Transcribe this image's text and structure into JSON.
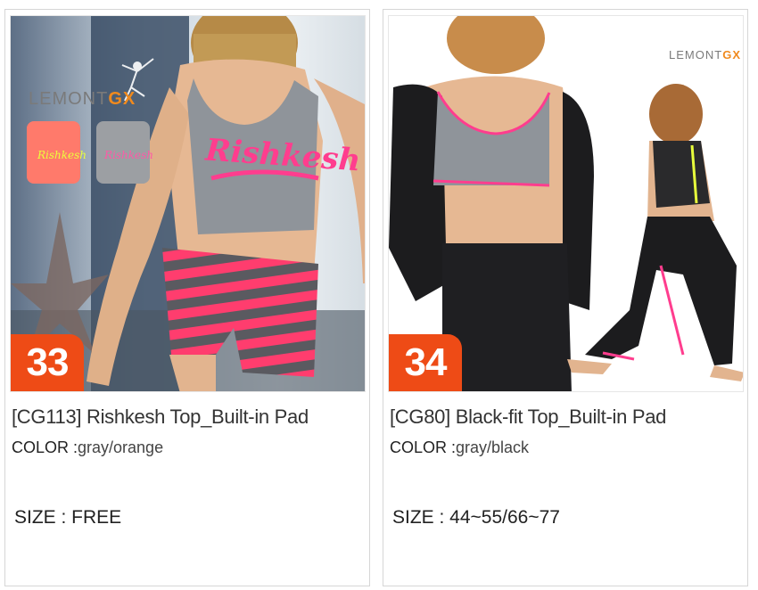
{
  "products": [
    {
      "badge_number": "33",
      "title": "[CG113] Rishkesh Top_Built-in Pad",
      "color_label": "COLOR :",
      "color_value": "gray/orange",
      "size_text": "SIZE : FREE",
      "brand_text": "LEMONT",
      "brand_accent": "GX",
      "shirt_print": "Rishkesh"
    },
    {
      "badge_number": "34",
      "title": "[CG80] Black-fit Top_Built-in Pad",
      "color_label": "COLOR :",
      "color_value": "gray/black",
      "size_text": "SIZE : 44~55/66~77",
      "brand_text": "LEMONT",
      "brand_accent": "GX"
    }
  ],
  "colors": {
    "badge": "#ee4b16",
    "brand_accent": "#f08a1e",
    "pink": "#ff4b7d",
    "gray_top": "#8f949a"
  },
  "icons": [
    "lemont-gx-logo-icon",
    "dancer-figure-icon"
  ]
}
